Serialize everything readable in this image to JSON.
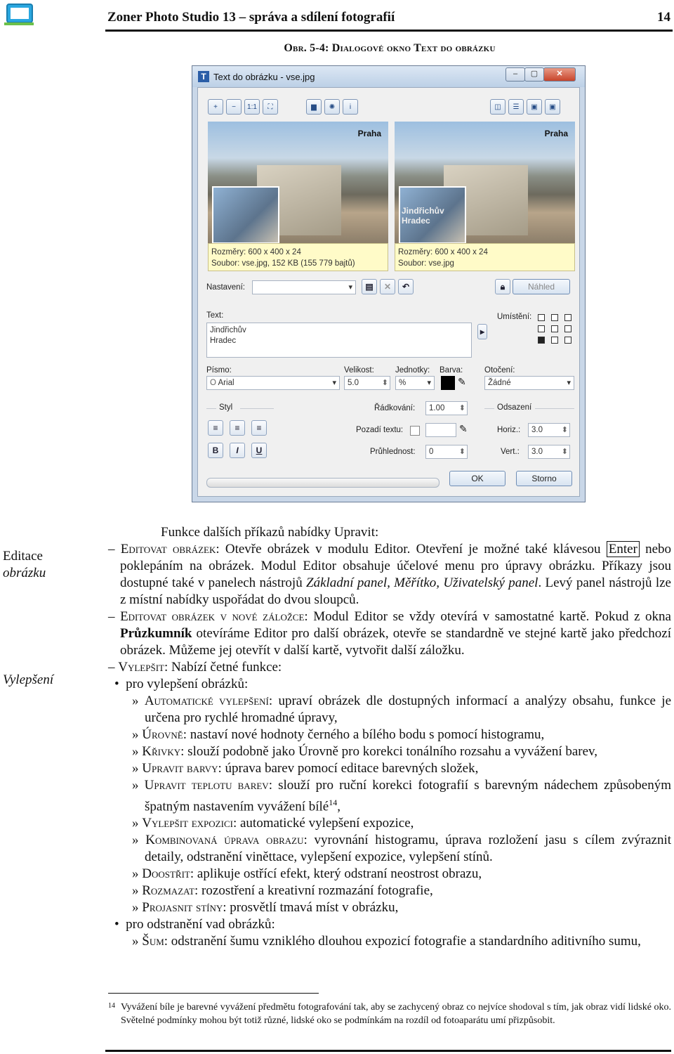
{
  "header": {
    "title": "Zoner Photo Studio 13 – správa a sdílení fotografií",
    "page_number": "14"
  },
  "figure_caption": "Obr. 5-4: Dialogové okno Text do obrázku",
  "dialog": {
    "title": "Text do obrázku - vse.jpg",
    "photo_left_label": "Praha",
    "photo_right_label": "Praha",
    "photo_right_overlay_1": "Jindřichův",
    "photo_right_overlay_2": "Hradec",
    "info_left_1": "Rozměry: 600 x 400 x 24",
    "info_left_2": "Soubor: vse.jpg, 152 KB (155 779 bajtů)",
    "info_right_1": "Rozměry: 600 x 400 x 24",
    "info_right_2": "Soubor: vse.jpg",
    "nastaveni_label": "Nastavení:",
    "nahled_label": "Náhled",
    "text_label": "Text:",
    "text_value_1": "Jindřichův",
    "text_value_2": "Hradec",
    "umisteni_label": "Umístění:",
    "pismo_label": "Písmo:",
    "pismo_value": "Arial",
    "velikost_label": "Velikost:",
    "velikost_value": "5.0",
    "jednotky_label": "Jednotky:",
    "jednotky_value": "%",
    "barva_label": "Barva:",
    "otoceni_label": "Otočení:",
    "otoceni_value": "Žádné",
    "styl_label": "Styl",
    "radkovani_label": "Řádkování:",
    "radkovani_value": "1.00",
    "pozadi_label": "Pozadí textu:",
    "pruhlednost_label": "Průhlednost:",
    "pruhlednost_value": "0",
    "odsazeni_label": "Odsazení",
    "horiz_label": "Horiz.:",
    "horiz_value": "3.0",
    "vert_label": "Vert.:",
    "vert_value": "3.0",
    "bold_label": "B",
    "italic_label": "I",
    "underline_label": "U",
    "ok_label": "OK",
    "storno_label": "Storno"
  },
  "margin_notes": {
    "editace_1": "Editace",
    "editace_2": "obrázku",
    "vylepseni": "Vylepšení"
  },
  "body": {
    "intro": "Funkce dalších příkazů nabídky Upravit:",
    "p1_term": "Editovat obrázek",
    "p1_text_a": ": Otevře obrázek v modulu Editor. Otevření je možné také klávesou",
    "p1_key": "Enter",
    "p1_text_b": " nebo poklepáním na obrázek. Modul Editor obsahuje účelové menu pro úpravy obrázku. Příkazy jsou dostupné také v panelech nástrojů ",
    "p1_italic": "Základní panel, Měřítko, Uživatelský panel",
    "p1_text_c": ". Levý panel nástrojů lze z místní nabídky uspořádat do dvou sloupců.",
    "p2_term": "Editovat obrázek v nové záložce",
    "p2_text_a": ": Modul Editor se vždy otevírá v samostatné kartě. Pokud z okna ",
    "p2_bold": "Průzkumník",
    "p2_text_b": " otevíráme Editor pro další obrázek, otevře se standardně ve stejné kartě jako předchozí obrázek. Můžeme jej otevřít v další kartě, vytvořit další záložku.",
    "p3_term": "Vylepšit",
    "p3_text": ": Nabízí četné funkce:",
    "b1": "pro vylepšení obrázků:",
    "items": [
      {
        "term": "Automatické vylepšení",
        "text": ": upraví obrázek dle dostupných informací a analýzy obsahu, funkce je určena pro rychlé hromadné úpravy,"
      },
      {
        "term": "Úrovně",
        "text": ": nastaví nové hodnoty černého a bílého bodu s pomocí histogramu,"
      },
      {
        "term": "Křivky",
        "text": ": slouží podobně jako Úrovně pro korekci tonálního rozsahu a vyvážení barev,"
      },
      {
        "term": "Upravit barvy",
        "text": ": úprava barev pomocí editace barevných složek,"
      },
      {
        "term": "Upravit teplotu barev",
        "text": ": slouží pro ruční korekci fotografií s barevným nádechem způsobeným špatným nastavením vyvážení bílé"
      },
      {
        "term": "Vylepšit expozici",
        "text": ": automatické vylepšení expozice,"
      },
      {
        "term": "Kombinovaná úprava obrazu",
        "text": ": vyrovnání histogramu, úprava rozložení jasu s cílem zvýraznit detaily, odstranění viněttace, vylepšení expozice, vylepšení stínů."
      },
      {
        "term": "Doostřit",
        "text": ": aplikuje ostřící efekt, který odstraní neostrost obrazu,"
      },
      {
        "term": "Rozmazat",
        "text": ": rozostření a kreativní rozmazání fotografie,"
      },
      {
        "term": "Projasnit stíny",
        "text": ": prosvětlí tmavá míst v obrázku,"
      }
    ],
    "item5_sup": "14",
    "item5_end": ",",
    "b2": "pro odstranění vad obrázků:",
    "sum_term": "Šum",
    "sum_text": ": odstranění šumu vzniklého dlouhou expozicí fotografie a standardního aditivního sumu,"
  },
  "footnote": {
    "number": "14",
    "text": "Vyvážení bíle je barevné vyvážení předmětu fotografování tak, aby se zachycený obraz co nejvíce shodoval s tím, jak obraz vidí lidské oko. Světelné podmínky mohou být totiž různé, lidské oko se podmínkám na rozdíl od fotoaparátu umí přizpůsobit."
  }
}
